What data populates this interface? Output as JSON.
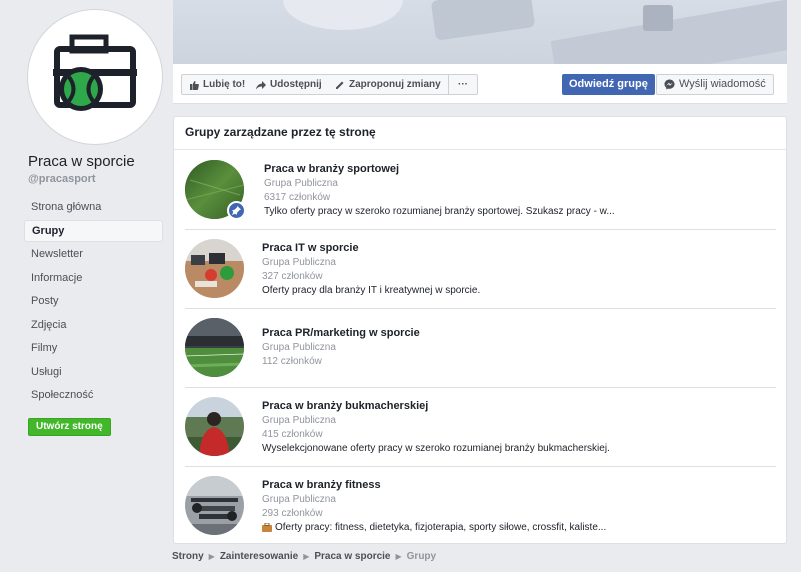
{
  "page": {
    "name": "Praca w sporcie",
    "handle": "@pracasport"
  },
  "nav": {
    "items": [
      {
        "label": "Strona główna"
      },
      {
        "label": "Grupy"
      },
      {
        "label": "Newsletter"
      },
      {
        "label": "Informacje"
      },
      {
        "label": "Posty"
      },
      {
        "label": "Zdjęcia"
      },
      {
        "label": "Filmy"
      },
      {
        "label": "Usługi"
      },
      {
        "label": "Społeczność"
      }
    ],
    "active": "Grupy",
    "create_button": "Utwórz stronę"
  },
  "actions": {
    "like": "Lubię to!",
    "share": "Udostępnij",
    "suggest": "Zaproponuj zmiany",
    "more": "···",
    "visit": "Odwiedź grupę",
    "message": "Wyślij wiadomość"
  },
  "card": {
    "title": "Grupy zarządzane przez tę stronę"
  },
  "groups": [
    {
      "name": "Praca w branży sportowej",
      "type": "Grupa Publiczna",
      "members": "6317 członków",
      "desc": "Tylko oferty pracy w szeroko rozumianej branży sportowej. Szukasz pracy - w..."
    },
    {
      "name": "Praca IT w sporcie",
      "type": "Grupa Publiczna",
      "members": "327 członków",
      "desc": "Oferty pracy dla branży IT i kreatywnej w sporcie."
    },
    {
      "name": "Praca PR/marketing w sporcie",
      "type": "Grupa Publiczna",
      "members": "112 członków",
      "desc": ""
    },
    {
      "name": "Praca w branży bukmacherskiej",
      "type": "Grupa Publiczna",
      "members": "415 członków",
      "desc": "Wyselekcjonowane oferty pracy w szeroko rozumianej branży bukmacherskiej."
    },
    {
      "name": "Praca w branży fitness",
      "type": "Grupa Publiczna",
      "members": "293 członków",
      "desc": "Oferty pracy: fitness, dietetyka, fizjoterapia, sporty siłowe, crossfit, kaliste..."
    }
  ],
  "breadcrumb": [
    "Strony",
    "Zainteresowanie",
    "Praca w sporcie",
    "Grupy"
  ],
  "colors": {
    "brand_blue": "#4267b2",
    "create_green": "#42b72a",
    "logo_green": "#2ea84a"
  }
}
